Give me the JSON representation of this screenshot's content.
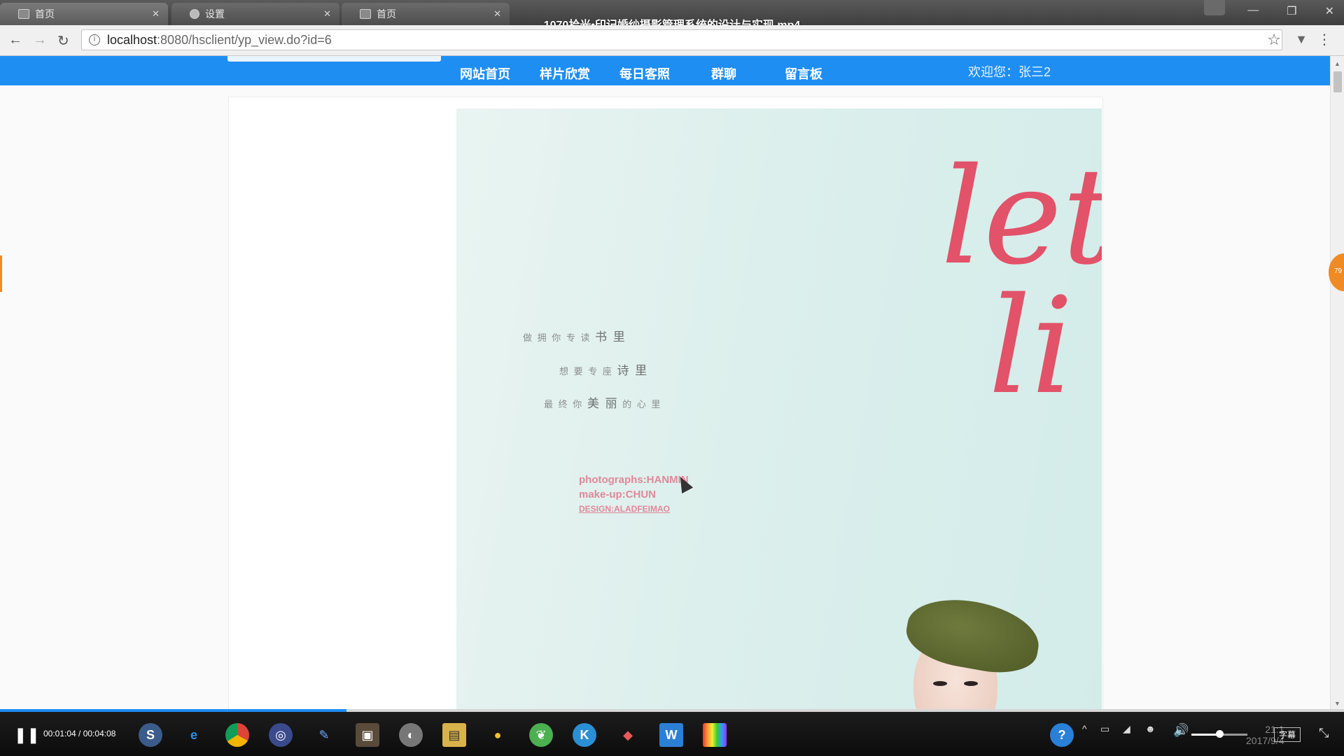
{
  "browser": {
    "tabs": [
      {
        "label": "首页",
        "icon": "image-icon"
      },
      {
        "label": "设置",
        "icon": "gear-icon"
      },
      {
        "label": "首页",
        "icon": "image-icon"
      }
    ],
    "url_host": "localhost",
    "url_path": ":8080/hsclient/yp_view.do?id=6",
    "window_buttons": [
      "—",
      "❐",
      "✕"
    ]
  },
  "video": {
    "title": "1070拾光•印记婚纱摄影管理系统的设计与实现.mp4",
    "time": "00:01:04 / 00:04:08",
    "progress": 0.258,
    "volume": 0.5,
    "subtitle_label": "字幕",
    "clock_time": "21:1",
    "clock_date": "2017/9/4"
  },
  "site": {
    "nav": [
      "网站首页",
      "样片欣赏",
      "每日客照",
      "群聊",
      "留言板"
    ],
    "welcome": "欢迎您：张三2"
  },
  "poster": {
    "lines": [
      {
        "small": "做 拥 你 专 读 ",
        "big": "书 里"
      },
      {
        "small": "想 要 专 座 ",
        "big": "诗 里"
      },
      {
        "small": "最 终 你 ",
        "big": "美 丽",
        "tail": " 的 心 里"
      }
    ],
    "credits": [
      "photographs:HANMIN",
      "make-up:CHUN",
      "DESIGN:ALADFEIMAO"
    ],
    "script_text": [
      "lette",
      "li"
    ]
  },
  "colors": {
    "nav_blue": "#1e8ef3",
    "script_pink": "#e25269",
    "poster_bg": "#dcefec"
  }
}
